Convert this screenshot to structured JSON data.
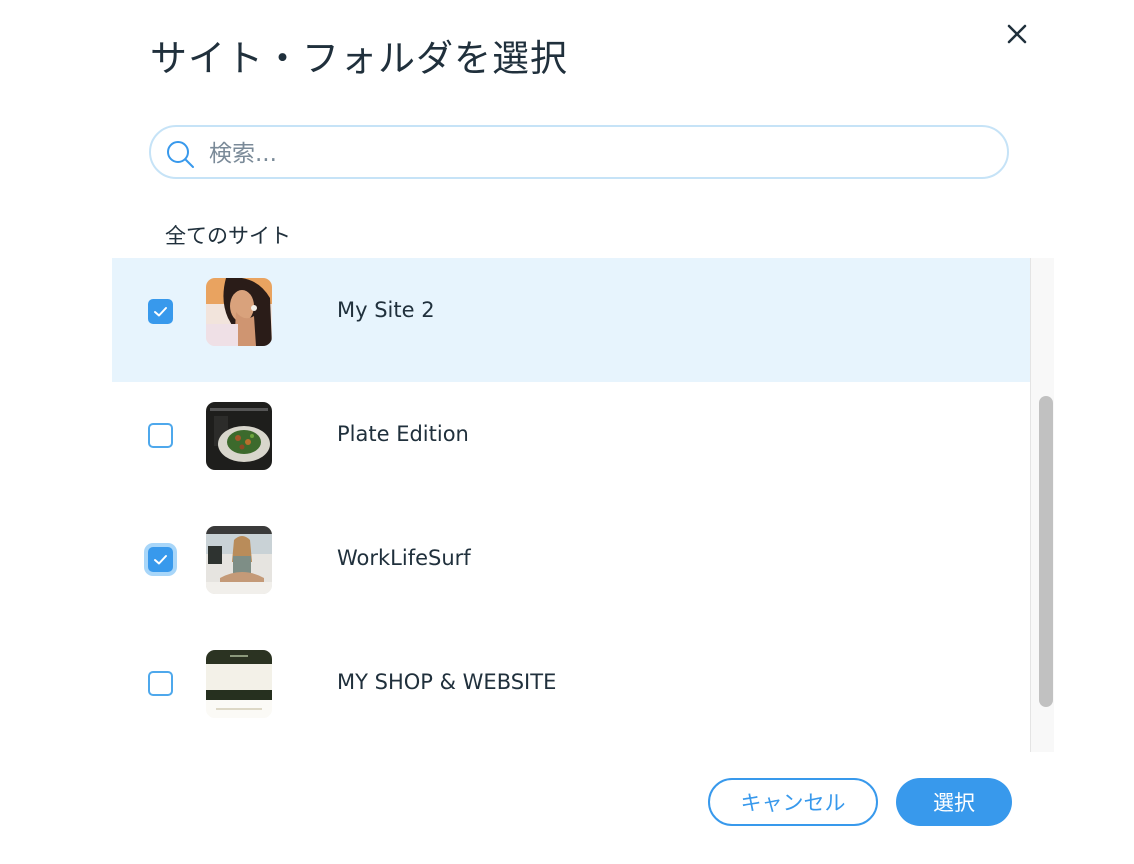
{
  "dialog": {
    "title": "サイト・フォルダを選択"
  },
  "search": {
    "placeholder": "検索..."
  },
  "section": {
    "label": "全てのサイト"
  },
  "sites": [
    {
      "name": "My Site 2",
      "checked": true,
      "thumb": "portrait-photo"
    },
    {
      "name": "Plate Edition",
      "checked": false,
      "thumb": "food-plate"
    },
    {
      "name": "WorkLifeSurf",
      "checked": true,
      "thumb": "beach-person"
    },
    {
      "name": "MY SHOP & WEBSITE",
      "checked": false,
      "thumb": "shop-page"
    }
  ],
  "footer": {
    "cancel_label": "キャンセル",
    "select_label": "選択"
  },
  "colors": {
    "accent": "#3899ec",
    "selected_row": "#e7f4fd",
    "text": "#20303c"
  }
}
